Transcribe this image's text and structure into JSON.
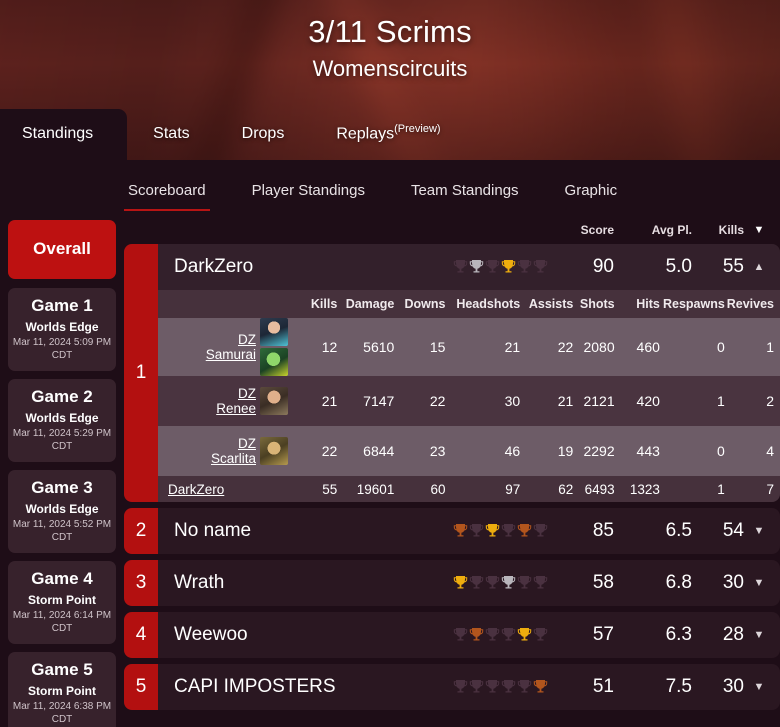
{
  "banner": {
    "title": "3/11 Scrims",
    "subtitle": "Womenscircuits"
  },
  "top_tabs": [
    {
      "label": "Standings",
      "sup": "",
      "active": true
    },
    {
      "label": "Stats",
      "sup": "",
      "active": false
    },
    {
      "label": "Drops",
      "sup": "",
      "active": false
    },
    {
      "label": "Replays",
      "sup": "(Preview)",
      "active": false
    }
  ],
  "sub_tabs": [
    {
      "label": "Scoreboard",
      "active": true
    },
    {
      "label": "Player Standings",
      "active": false
    },
    {
      "label": "Team Standings",
      "active": false
    },
    {
      "label": "Graphic",
      "active": false
    }
  ],
  "sidebar": {
    "overall": {
      "label": "Overall",
      "active": true
    },
    "games": [
      {
        "name": "Game 1",
        "map": "Worlds Edge",
        "time": "Mar 11, 2024 5:09 PM CDT"
      },
      {
        "name": "Game 2",
        "map": "Worlds Edge",
        "time": "Mar 11, 2024 5:29 PM CDT"
      },
      {
        "name": "Game 3",
        "map": "Worlds Edge",
        "time": "Mar 11, 2024 5:52 PM CDT"
      },
      {
        "name": "Game 4",
        "map": "Storm Point",
        "time": "Mar 11, 2024 6:14 PM CDT"
      },
      {
        "name": "Game 5",
        "map": "Storm Point",
        "time": "Mar 11, 2024 6:38 PM CDT"
      }
    ]
  },
  "table": {
    "headers": {
      "score": "Score",
      "avg": "Avg Pl.",
      "kills": "Kills"
    },
    "sort_caret": "▼",
    "collapse_caret": "▲",
    "expand_caret": "▼"
  },
  "player_headers": [
    "Kills",
    "Damage",
    "Downs",
    "Headshots",
    "Assists",
    "Shots",
    "Hits",
    "Respawns",
    "Revives"
  ],
  "colors": {
    "accent_red": "#b31010",
    "overall_red": "#bd1111",
    "gold": "#eead0e",
    "silver": "#b9b6bc",
    "bronze": "#b2551d",
    "empty_trophy": "#4a3140",
    "panel": "#1e0d17",
    "tab_underline": "#b81414"
  },
  "teams": [
    {
      "rank": "1",
      "name": "DarkZero",
      "score": "90",
      "avg": "5.0",
      "kills": "55",
      "trophies": [
        "empty",
        "silver",
        "empty",
        "gold",
        "empty",
        "empty"
      ],
      "expanded": true,
      "players": [
        {
          "tag": "DZ",
          "name": "Samurai",
          "legends": [
            "legend-a",
            "legend-b"
          ],
          "kills": "12",
          "damage": "5610",
          "downs": "15",
          "headshots": "21",
          "assists": "22",
          "shots": "2080",
          "hits": "460",
          "respawns": "0",
          "revives": "1"
        },
        {
          "tag": "DZ",
          "name": "Renee",
          "legends": [
            "legend-c"
          ],
          "kills": "21",
          "damage": "7147",
          "downs": "22",
          "headshots": "30",
          "assists": "21",
          "shots": "2121",
          "hits": "420",
          "respawns": "1",
          "revives": "2"
        },
        {
          "tag": "DZ",
          "name": "Scarlita",
          "legends": [
            "legend-d"
          ],
          "kills": "22",
          "damage": "6844",
          "downs": "23",
          "headshots": "46",
          "assists": "19",
          "shots": "2292",
          "hits": "443",
          "respawns": "0",
          "revives": "4"
        }
      ],
      "totals": {
        "label": "DarkZero",
        "kills": "55",
        "damage": "19601",
        "downs": "60",
        "headshots": "97",
        "assists": "62",
        "shots": "6493",
        "hits": "1323",
        "respawns": "1",
        "revives": "7"
      }
    },
    {
      "rank": "2",
      "name": "No name",
      "score": "85",
      "avg": "6.5",
      "kills": "54",
      "trophies": [
        "bronze",
        "empty",
        "gold",
        "empty",
        "bronze",
        "empty"
      ],
      "expanded": false
    },
    {
      "rank": "3",
      "name": "Wrath",
      "score": "58",
      "avg": "6.8",
      "kills": "30",
      "trophies": [
        "gold",
        "empty",
        "empty",
        "silver",
        "empty",
        "empty"
      ],
      "expanded": false
    },
    {
      "rank": "4",
      "name": "Weewoo",
      "score": "57",
      "avg": "6.3",
      "kills": "28",
      "trophies": [
        "empty",
        "bronze",
        "empty",
        "empty",
        "gold",
        "empty"
      ],
      "expanded": false
    },
    {
      "rank": "5",
      "name": "CAPI IMPOSTERS",
      "score": "51",
      "avg": "7.5",
      "kills": "30",
      "trophies": [
        "empty",
        "empty",
        "empty",
        "empty",
        "empty",
        "bronze"
      ],
      "expanded": false
    }
  ]
}
